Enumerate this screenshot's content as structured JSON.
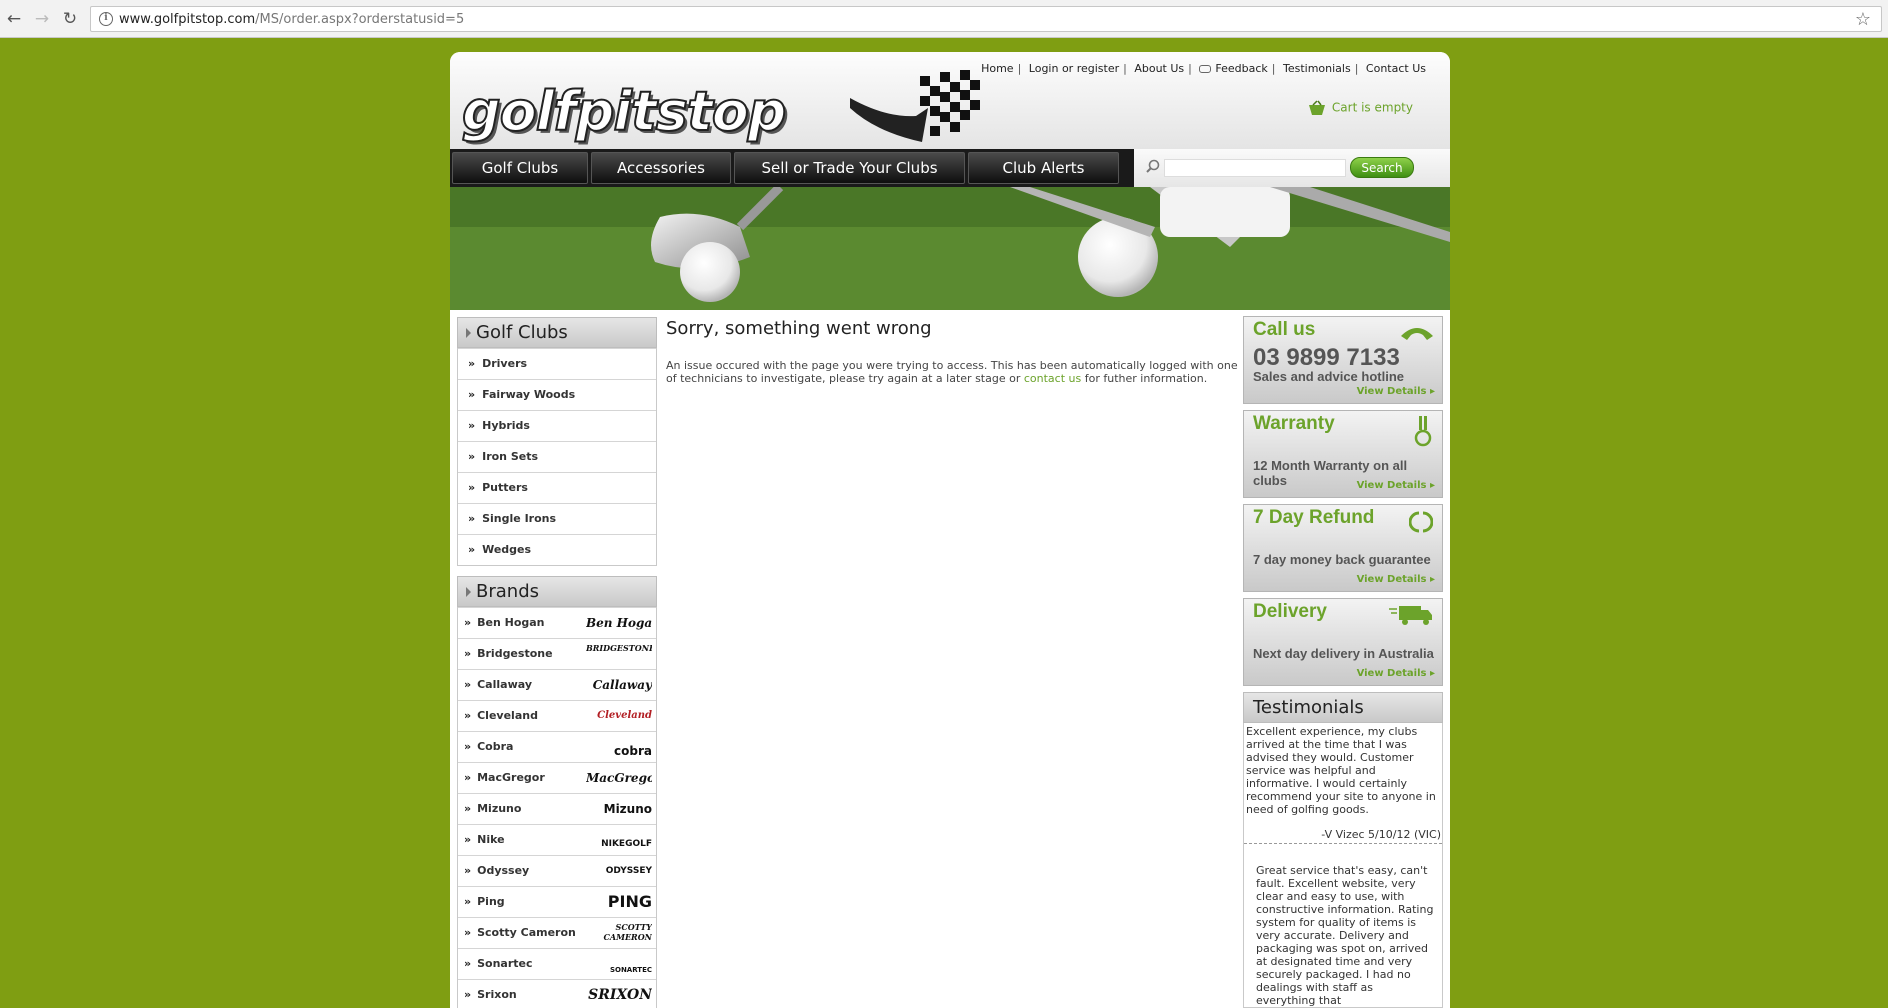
{
  "browser": {
    "url_domain": "www.golfpitstop.com",
    "url_path": "/MS/order.aspx?orderstatusid=5"
  },
  "header": {
    "logo_text": "golfpitstop",
    "links": [
      "Home",
      "Login or register",
      "About Us",
      "Feedback",
      "Testimonials",
      "Contact Us"
    ],
    "cart_text": "Cart is empty"
  },
  "nav": {
    "items": [
      "Golf Clubs",
      "Accessories",
      "Sell or Trade Your Clubs",
      "Club Alerts"
    ],
    "search_button": "Search"
  },
  "left": {
    "clubs_title": "Golf Clubs",
    "clubs": [
      "Drivers",
      "Fairway Woods",
      "Hybrids",
      "Iron Sets",
      "Putters",
      "Single Irons",
      "Wedges"
    ],
    "brands_title": "Brands",
    "brands": [
      {
        "name": "Ben Hogan",
        "logo": "Ben Hogan"
      },
      {
        "name": "Bridgestone",
        "logo": "BRIDGESTONE GOLF"
      },
      {
        "name": "Callaway",
        "logo": "Callaway"
      },
      {
        "name": "Cleveland",
        "logo": "Cleveland"
      },
      {
        "name": "Cobra",
        "logo": "cobra"
      },
      {
        "name": "MacGregor",
        "logo": "MacGregor"
      },
      {
        "name": "Mizuno",
        "logo": "Mizuno"
      },
      {
        "name": "Nike",
        "logo": "NIKEGOLF"
      },
      {
        "name": "Odyssey",
        "logo": "ODYSSEY"
      },
      {
        "name": "Ping",
        "logo": "PING"
      },
      {
        "name": "Scotty Cameron",
        "logo": "SCOTTY CAMERON"
      },
      {
        "name": "Sonartec",
        "logo": "SONARTEC"
      },
      {
        "name": "Srixon",
        "logo": "SRIXON"
      }
    ]
  },
  "main": {
    "title": "Sorry, something went wrong",
    "body_before": "An issue occured with the page you were trying to access.  This has been automatically logged with one of technicians to investigate, please try again at a later stage or ",
    "link": "contact us",
    "body_after": " for futher information."
  },
  "right": {
    "call": {
      "title": "Call us",
      "number": "03 9899 7133",
      "sub": "Sales and advice hotline",
      "details": "View Details"
    },
    "warranty": {
      "title": "Warranty",
      "text": "12 Month Warranty on all clubs",
      "details": "View Details"
    },
    "refund": {
      "title": "7 Day Refund",
      "text": "7 day money back guarantee",
      "details": "View Details"
    },
    "delivery": {
      "title": "Delivery",
      "text": "Next day delivery in Australia",
      "details": "View Details"
    },
    "testimonials_title": "Testimonials",
    "testimonial1": "Excellent experience, my clubs arrived at the time that I was advised they would. Customer service was helpful and informative. I would certainly recommend your site to anyone in need of golfing goods.",
    "testimonial1_author": "-V Vizec 5/10/12 (VIC)",
    "testimonial2": "Great service that's easy, can't fault. Excellent website, very clear and easy to use, with constructive information. Rating system for quality of items is very accurate. Delivery and packaging was spot on, arrived at designated time and very securely packaged. I had no dealings with staff as everything that"
  },
  "colors": {
    "background": "#7f9e12",
    "accent_green": "#6ca32b",
    "nav_dark": "#1a1a1a"
  },
  "icons": [
    "back-icon",
    "forward-icon",
    "reload-icon",
    "info-icon",
    "star-icon",
    "cart-icon",
    "search-icon",
    "phone-icon",
    "medal-icon",
    "refund-icon",
    "truck-icon"
  ]
}
